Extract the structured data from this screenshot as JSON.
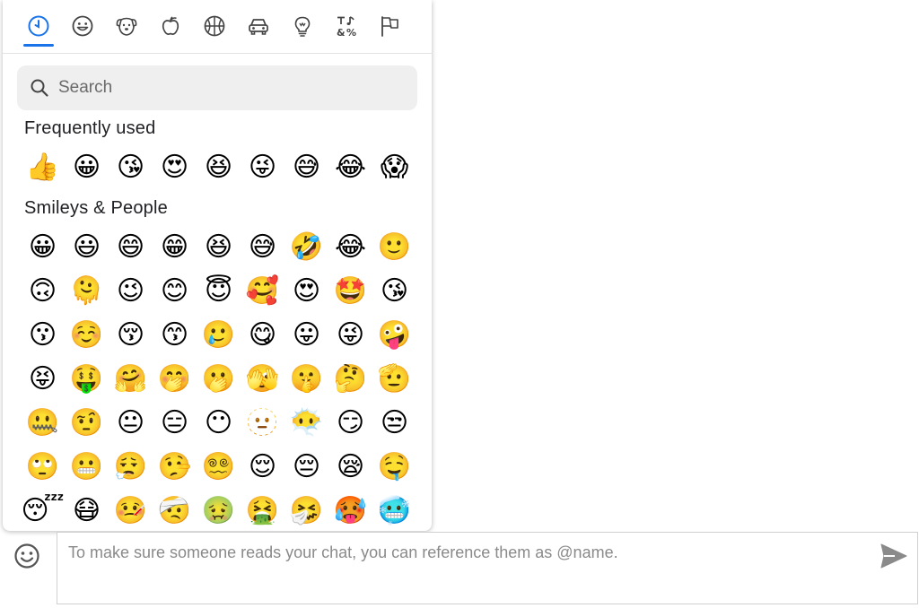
{
  "picker": {
    "category_tabs": [
      {
        "name": "recent",
        "icon": "clock-icon",
        "active": true
      },
      {
        "name": "smileys",
        "icon": "smiley-face-icon",
        "active": false
      },
      {
        "name": "animals",
        "icon": "dog-face-icon",
        "active": false
      },
      {
        "name": "food",
        "icon": "apple-icon",
        "active": false
      },
      {
        "name": "activities",
        "icon": "basketball-icon",
        "active": false
      },
      {
        "name": "travel",
        "icon": "car-icon",
        "active": false
      },
      {
        "name": "objects",
        "icon": "lightbulb-icon",
        "active": false
      },
      {
        "name": "symbols",
        "icon": "symbols-icon",
        "active": false
      },
      {
        "name": "flags",
        "icon": "flag-icon",
        "active": false
      }
    ],
    "accent_color": "#1a73e8",
    "search": {
      "placeholder": "Search",
      "value": ""
    },
    "sections": [
      {
        "title": "Frequently used",
        "emojis": [
          "👍",
          "😀",
          "😘",
          "😍",
          "😆",
          "😜",
          "😅",
          "😂",
          "😱"
        ]
      },
      {
        "title": "Smileys & People",
        "emojis": [
          "😀",
          "😃",
          "😄",
          "😁",
          "😆",
          "😅",
          "🤣",
          "😂",
          "🙂",
          "🙃",
          "🫠",
          "😉",
          "😊",
          "😇",
          "🥰",
          "😍",
          "🤩",
          "😘",
          "😗",
          "☺️",
          "😚",
          "😙",
          "🥲",
          "😋",
          "😛",
          "😜",
          "🤪",
          "😝",
          "🤑",
          "🤗",
          "🤭",
          "🫢",
          "🫣",
          "🤫",
          "🤔",
          "🫡",
          "🤐",
          "🤨",
          "😐",
          "😑",
          "😶",
          "🫥",
          "😶‍🌫️",
          "😏",
          "😒",
          "🙄",
          "😬",
          "😮‍💨",
          "🤥",
          "😵‍💫",
          "😌",
          "😔",
          "😪",
          "🤤",
          "😴",
          "😷",
          "🤒",
          "🤕",
          "🤢",
          "🤮",
          "🤧",
          "🥵",
          "🥶"
        ]
      }
    ]
  },
  "compose": {
    "placeholder": "To make sure someone reads your chat, you can reference them as @name.",
    "value": ""
  }
}
